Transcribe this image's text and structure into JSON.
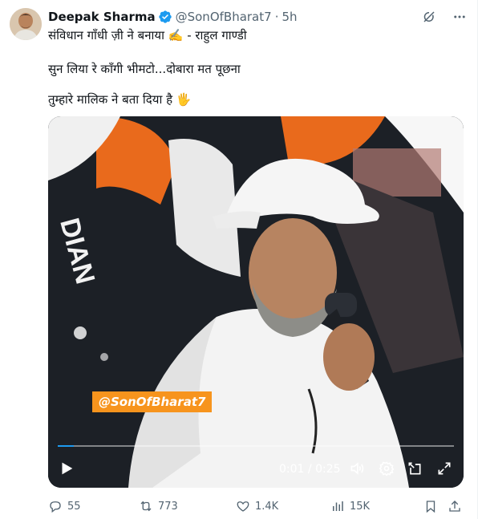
{
  "tweet": {
    "author_name": "Deepak Sharma",
    "handle": "@SonOfBharat7",
    "separator": "·",
    "time": "5h",
    "lines": [
      "संविधान गाँधी ज़ी ने बनाया ✍️ - राहुल गाण्डी",
      "सुन लिया रे कॉंगी भीमटो...दोबारा मत पूछना",
      "तुम्हारे मालिक ने बता दिया है 🖐"
    ]
  },
  "media": {
    "watermark": "@SonOfBharat7",
    "time_current": "0:01",
    "time_total": "0:25",
    "time_separator": " / ",
    "progress": 0.04
  },
  "actions": {
    "replies": "55",
    "reposts": "773",
    "likes": "1.4K",
    "views": "15K"
  },
  "colors": {
    "accent": "#1d9bf0",
    "muted": "#536471",
    "text": "#0f1419",
    "watermark_bg": "#f7941d"
  },
  "icons": [
    "verified-badge-icon",
    "grok-icon",
    "more-icon",
    "play-icon",
    "volume-icon",
    "settings-icon",
    "minimize-icon",
    "fullscreen-icon",
    "reply-icon",
    "repost-icon",
    "like-icon",
    "views-icon",
    "bookmark-icon",
    "share-icon"
  ]
}
